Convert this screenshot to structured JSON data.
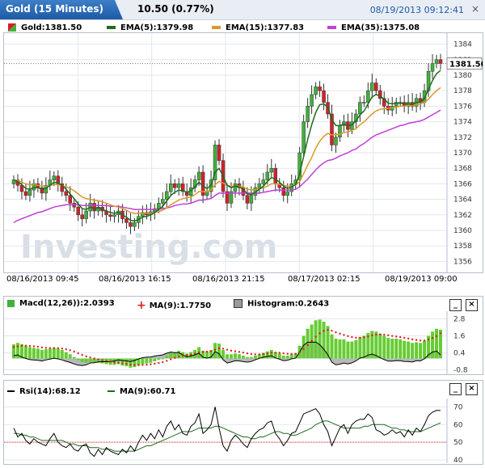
{
  "header": {
    "title": "Gold (15 Minutes)",
    "change": "10.50 (0.77%)",
    "timestamp": "08/19/2013 09:12:41",
    "close_label": "×"
  },
  "main_legend": {
    "price": "Gold:1381.50",
    "ema5": "EMA(5):1379.98",
    "ema15": "EMA(15):1377.83",
    "ema35": "EMA(35):1375.08"
  },
  "macd_legend": {
    "macd": "Macd(12,26)):2.0393",
    "ma": "MA(9):1.7750",
    "hist": "Histogram:0.2643",
    "minimize": "_",
    "close": "×"
  },
  "rsi_legend": {
    "rsi": "Rsi(14):68.12",
    "ma": "MA(9):60.71",
    "minimize": "_",
    "close": "×"
  },
  "watermark": "Investing.com",
  "colors": {
    "up": "#41b13a",
    "down": "#d4202a",
    "ema5": "#1f6b1f",
    "ema15": "#d89a2a",
    "ema35": "#c040d8",
    "macd_bar": "#66cc33",
    "macd_signal": "#e02020",
    "histogram": "#9a9a9a"
  },
  "chart_data": [
    {
      "type": "candlestick",
      "ylim": [
        1355,
        1385
      ],
      "yticks": [
        1356,
        1358,
        1360,
        1362,
        1364,
        1366,
        1368,
        1370,
        1372,
        1374,
        1376,
        1378,
        1380,
        1382,
        1384
      ],
      "x_labels": [
        "08/16/2013 09:45",
        "08/16/2013 16:15",
        "08/16/2013 21:15",
        "08/17/2013 02:15",
        "08/19/2013 09:00"
      ],
      "last_price": "1381.50",
      "close": [
        1366.5,
        1365.8,
        1365.0,
        1364.5,
        1365.2,
        1366.0,
        1365.5,
        1364.8,
        1365.8,
        1366.5,
        1367.0,
        1366.0,
        1365.0,
        1364.5,
        1363.5,
        1363.0,
        1362.0,
        1361.5,
        1362.5,
        1363.5,
        1362.5,
        1363.0,
        1362.5,
        1362.0,
        1361.8,
        1362.0,
        1362.5,
        1361.5,
        1361.0,
        1360.5,
        1361.0,
        1361.8,
        1362.3,
        1362.0,
        1362.4,
        1362.8,
        1363.5,
        1364.0,
        1365.0,
        1366.0,
        1365.5,
        1366.0,
        1365.0,
        1364.5,
        1365.5,
        1366.5,
        1367.5,
        1364.5,
        1365.0,
        1366.5,
        1371.0,
        1369.0,
        1365.0,
        1363.5,
        1365.0,
        1366.0,
        1365.5,
        1364.5,
        1363.5,
        1364.5,
        1365.5,
        1366.0,
        1366.5,
        1367.5,
        1368.0,
        1366.0,
        1365.5,
        1364.5,
        1365.0,
        1366.0,
        1366.5,
        1370.0,
        1374.0,
        1376.0,
        1377.5,
        1378.5,
        1378.0,
        1376.5,
        1375.0,
        1371.0,
        1372.0,
        1373.5,
        1374.0,
        1373.0,
        1374.0,
        1375.0,
        1376.5,
        1376.5,
        1378.0,
        1379.0,
        1378.0,
        1377.0,
        1376.0,
        1375.5,
        1376.0,
        1376.5,
        1376.5,
        1376.0,
        1376.5,
        1376.0,
        1377.0,
        1376.5,
        1378.0,
        1380.5,
        1381.5,
        1382.0,
        1381.5
      ],
      "ema5": [
        1366.5,
        1366.3,
        1365.9,
        1365.4,
        1365.3,
        1365.5,
        1365.5,
        1365.3,
        1365.4,
        1365.8,
        1366.2,
        1366.1,
        1365.8,
        1365.3,
        1364.7,
        1364.1,
        1363.4,
        1362.8,
        1362.7,
        1363.0,
        1362.8,
        1362.9,
        1362.7,
        1362.5,
        1362.3,
        1362.2,
        1362.3,
        1362.0,
        1361.7,
        1361.3,
        1361.2,
        1361.4,
        1361.7,
        1361.8,
        1362.0,
        1362.3,
        1362.7,
        1363.1,
        1363.8,
        1364.5,
        1364.9,
        1365.2,
        1365.1,
        1364.9,
        1365.1,
        1365.6,
        1366.2,
        1365.7,
        1365.4,
        1365.8,
        1367.5,
        1368.0,
        1367.0,
        1365.8,
        1365.5,
        1365.7,
        1365.6,
        1365.3,
        1364.7,
        1364.6,
        1364.9,
        1365.3,
        1365.7,
        1366.3,
        1366.8,
        1366.6,
        1366.2,
        1365.7,
        1365.4,
        1365.6,
        1365.9,
        1367.3,
        1369.5,
        1371.7,
        1373.6,
        1375.2,
        1376.2,
        1376.3,
        1375.9,
        1374.3,
        1373.5,
        1373.5,
        1373.7,
        1373.5,
        1373.6,
        1374.1,
        1374.9,
        1375.4,
        1376.3,
        1377.2,
        1377.5,
        1377.3,
        1376.9,
        1376.4,
        1376.3,
        1376.4,
        1376.4,
        1376.3,
        1376.3,
        1376.2,
        1376.5,
        1376.5,
        1377.0,
        1378.2,
        1379.3,
        1380.2,
        1380.6
      ],
      "ema15": [
        1366.5,
        1366.4,
        1366.2,
        1366.0,
        1365.9,
        1365.9,
        1365.8,
        1365.7,
        1365.7,
        1365.8,
        1365.9,
        1365.9,
        1365.8,
        1365.6,
        1365.4,
        1365.1,
        1364.7,
        1364.3,
        1364.1,
        1364.0,
        1363.9,
        1363.8,
        1363.7,
        1363.5,
        1363.3,
        1363.1,
        1363.0,
        1362.8,
        1362.6,
        1362.3,
        1362.2,
        1362.2,
        1362.2,
        1362.2,
        1362.2,
        1362.3,
        1362.4,
        1362.6,
        1362.9,
        1363.3,
        1363.6,
        1363.9,
        1364.1,
        1364.2,
        1364.3,
        1364.6,
        1365.0,
        1365.0,
        1365.0,
        1365.2,
        1365.9,
        1366.3,
        1366.1,
        1365.8,
        1365.7,
        1365.7,
        1365.7,
        1365.6,
        1365.3,
        1365.2,
        1365.3,
        1365.4,
        1365.5,
        1365.7,
        1366.0,
        1366.0,
        1365.9,
        1365.8,
        1365.7,
        1365.7,
        1365.8,
        1366.3,
        1367.3,
        1368.4,
        1369.4,
        1370.6,
        1371.5,
        1372.1,
        1372.5,
        1372.3,
        1372.3,
        1372.4,
        1372.6,
        1372.7,
        1372.9,
        1373.1,
        1373.6,
        1374.0,
        1374.5,
        1375.0,
        1375.4,
        1375.6,
        1375.7,
        1375.7,
        1375.8,
        1375.9,
        1376.0,
        1376.0,
        1376.1,
        1376.1,
        1376.2,
        1376.3,
        1376.5,
        1376.9,
        1377.5,
        1378.0,
        1378.4
      ],
      "ema35": [
        1361.0,
        1361.3,
        1361.5,
        1361.7,
        1361.9,
        1362.1,
        1362.3,
        1362.4,
        1362.6,
        1362.8,
        1363.0,
        1363.1,
        1363.2,
        1363.3,
        1363.3,
        1363.3,
        1363.3,
        1363.2,
        1363.2,
        1363.2,
        1363.2,
        1363.2,
        1363.2,
        1363.2,
        1363.1,
        1363.1,
        1363.1,
        1363.0,
        1362.9,
        1362.8,
        1362.7,
        1362.7,
        1362.7,
        1362.7,
        1362.7,
        1362.7,
        1362.7,
        1362.8,
        1362.9,
        1363.0,
        1363.2,
        1363.3,
        1363.4,
        1363.4,
        1363.5,
        1363.7,
        1363.9,
        1363.9,
        1364.0,
        1364.1,
        1364.5,
        1364.8,
        1364.8,
        1364.8,
        1364.8,
        1364.8,
        1364.8,
        1364.8,
        1364.8,
        1364.8,
        1364.8,
        1364.8,
        1364.9,
        1365.0,
        1365.1,
        1365.2,
        1365.2,
        1365.2,
        1365.2,
        1365.2,
        1365.3,
        1365.6,
        1366.1,
        1366.6,
        1367.2,
        1367.8,
        1368.3,
        1368.7,
        1369.0,
        1369.1,
        1369.3,
        1369.6,
        1369.8,
        1370.0,
        1370.3,
        1370.5,
        1370.9,
        1371.2,
        1371.6,
        1372.0,
        1372.3,
        1372.5,
        1372.7,
        1372.9,
        1373.1,
        1373.3,
        1373.5,
        1373.6,
        1373.8,
        1373.9,
        1374.0,
        1374.1,
        1374.3,
        1374.6,
        1374.9,
        1375.2,
        1375.5
      ]
    },
    {
      "type": "bar",
      "title": "Macd(12,26)",
      "ylim": [
        -1.0,
        3.0
      ],
      "yticks": [
        -0.8,
        0.4,
        1.6,
        2.8
      ],
      "macd": [
        1.0,
        1.1,
        1.0,
        0.9,
        0.8,
        0.75,
        0.7,
        0.6,
        0.65,
        0.7,
        0.75,
        0.7,
        0.6,
        0.45,
        0.3,
        0.1,
        -0.1,
        -0.25,
        -0.3,
        -0.25,
        -0.3,
        -0.3,
        -0.35,
        -0.4,
        -0.45,
        -0.45,
        -0.4,
        -0.5,
        -0.55,
        -0.65,
        -0.6,
        -0.5,
        -0.4,
        -0.35,
        -0.3,
        -0.2,
        -0.1,
        0.0,
        0.2,
        0.4,
        0.45,
        0.55,
        0.45,
        0.35,
        0.45,
        0.6,
        0.8,
        0.55,
        0.5,
        0.6,
        1.1,
        1.05,
        0.6,
        0.3,
        0.3,
        0.35,
        0.3,
        0.2,
        0.1,
        0.1,
        0.2,
        0.3,
        0.4,
        0.5,
        0.6,
        0.45,
        0.35,
        0.2,
        0.2,
        0.3,
        0.35,
        0.9,
        1.6,
        2.1,
        2.4,
        2.7,
        2.75,
        2.6,
        2.3,
        1.7,
        1.4,
        1.35,
        1.35,
        1.2,
        1.2,
        1.3,
        1.5,
        1.6,
        1.8,
        1.95,
        1.9,
        1.75,
        1.6,
        1.45,
        1.4,
        1.4,
        1.35,
        1.25,
        1.2,
        1.1,
        1.15,
        1.1,
        1.25,
        1.6,
        1.9,
        2.1,
        2.04
      ],
      "signal": [
        0.8,
        0.85,
        0.9,
        0.9,
        0.88,
        0.86,
        0.83,
        0.78,
        0.75,
        0.74,
        0.74,
        0.73,
        0.7,
        0.65,
        0.58,
        0.49,
        0.37,
        0.25,
        0.15,
        0.07,
        0.0,
        -0.06,
        -0.12,
        -0.17,
        -0.22,
        -0.27,
        -0.3,
        -0.34,
        -0.38,
        -0.43,
        -0.46,
        -0.47,
        -0.46,
        -0.44,
        -0.41,
        -0.37,
        -0.32,
        -0.26,
        -0.17,
        -0.06,
        0.04,
        0.14,
        0.2,
        0.23,
        0.27,
        0.34,
        0.43,
        0.46,
        0.48,
        0.5,
        0.62,
        0.71,
        0.69,
        0.62,
        0.55,
        0.51,
        0.47,
        0.42,
        0.36,
        0.31,
        0.29,
        0.29,
        0.31,
        0.35,
        0.4,
        0.41,
        0.4,
        0.36,
        0.33,
        0.32,
        0.33,
        0.44,
        0.67,
        0.95,
        1.25,
        1.54,
        1.78,
        1.95,
        2.02,
        1.96,
        1.85,
        1.75,
        1.67,
        1.58,
        1.51,
        1.47,
        1.47,
        1.5,
        1.56,
        1.64,
        1.69,
        1.7,
        1.68,
        1.64,
        1.59,
        1.55,
        1.51,
        1.46,
        1.41,
        1.35,
        1.31,
        1.27,
        1.27,
        1.34,
        1.45,
        1.58,
        1.78
      ],
      "histogram": [
        0.2,
        0.25,
        0.1,
        0.0,
        -0.08,
        -0.11,
        -0.13,
        -0.18,
        -0.1,
        -0.04,
        0.01,
        -0.03,
        -0.1,
        -0.2,
        -0.28,
        -0.39,
        -0.47,
        -0.5,
        -0.45,
        -0.32,
        -0.3,
        -0.24,
        -0.23,
        -0.23,
        -0.23,
        -0.18,
        -0.1,
        -0.16,
        -0.17,
        -0.22,
        -0.14,
        -0.03,
        0.06,
        0.09,
        0.11,
        0.17,
        0.22,
        0.26,
        0.37,
        0.46,
        0.41,
        0.41,
        0.25,
        0.12,
        0.18,
        0.26,
        0.37,
        0.09,
        0.02,
        0.1,
        0.48,
        0.34,
        -0.09,
        -0.32,
        -0.25,
        -0.16,
        -0.17,
        -0.22,
        -0.26,
        -0.21,
        -0.09,
        0.01,
        0.09,
        0.15,
        0.2,
        0.04,
        -0.05,
        -0.16,
        -0.13,
        -0.02,
        0.02,
        0.46,
        0.93,
        1.15,
        1.15,
        1.16,
        0.97,
        0.65,
        0.28,
        -0.26,
        -0.45,
        -0.4,
        -0.32,
        -0.38,
        -0.31,
        -0.17,
        0.03,
        0.1,
        0.24,
        0.31,
        0.21,
        0.05,
        -0.08,
        -0.19,
        -0.19,
        -0.15,
        -0.16,
        -0.21,
        -0.21,
        -0.25,
        -0.16,
        -0.17,
        -0.02,
        0.26,
        0.45,
        0.52,
        0.26
      ]
    },
    {
      "type": "line",
      "title": "Rsi(14)",
      "ylim": [
        40,
        72
      ],
      "yticks": [
        40,
        50,
        60,
        70
      ],
      "reference_line": 50,
      "rsi": [
        58,
        53,
        55,
        51,
        49,
        52,
        50,
        49,
        48,
        52,
        55,
        50,
        48,
        47,
        49,
        46,
        45,
        48,
        49,
        44,
        42,
        46,
        43,
        47,
        45,
        44,
        43,
        46,
        44,
        48,
        45,
        50,
        54,
        51,
        55,
        52,
        57,
        53,
        59,
        62,
        57,
        60,
        55,
        54,
        59,
        61,
        66,
        55,
        57,
        60,
        70,
        58,
        48,
        45,
        51,
        54,
        52,
        49,
        47,
        52,
        55,
        57,
        58,
        61,
        62,
        55,
        52,
        48,
        51,
        55,
        56,
        61,
        66,
        67,
        68,
        69,
        66,
        60,
        56,
        48,
        53,
        58,
        60,
        55,
        60,
        62,
        63,
        63,
        66,
        64,
        57,
        56,
        54,
        55,
        57,
        55,
        56,
        53,
        57,
        54,
        58,
        56,
        60,
        65,
        67,
        68,
        68
      ],
      "ma": [
        55,
        55,
        54,
        54,
        53,
        53,
        52,
        51,
        51,
        51,
        51,
        51,
        51,
        50,
        49,
        49,
        48,
        48,
        48,
        47,
        47,
        47,
        46,
        46,
        46,
        45,
        45,
        45,
        45,
        45,
        45,
        46,
        47,
        48,
        48,
        49,
        50,
        51,
        52,
        53,
        54,
        55,
        56,
        56,
        56,
        57,
        58,
        58,
        58,
        58,
        59,
        59,
        58,
        57,
        56,
        55,
        54,
        53,
        53,
        52,
        52,
        53,
        53,
        54,
        55,
        56,
        56,
        55,
        55,
        54,
        54,
        55,
        56,
        57,
        58,
        60,
        61,
        62,
        62,
        61,
        60,
        59,
        58,
        58,
        58,
        58,
        58,
        59,
        59,
        60,
        60,
        60,
        60,
        59,
        58,
        58,
        57,
        57,
        56,
        56,
        56,
        56,
        57,
        58,
        59,
        60,
        61
      ]
    }
  ]
}
